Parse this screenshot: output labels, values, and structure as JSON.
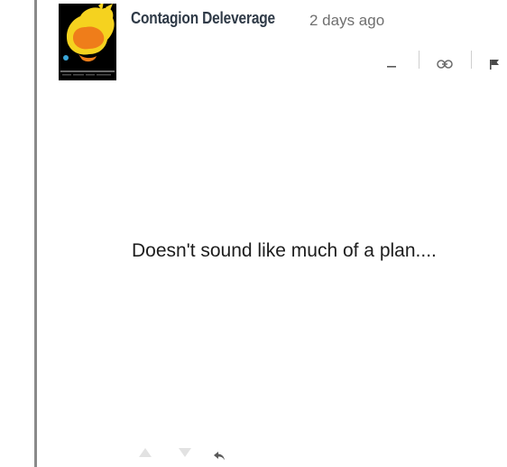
{
  "comment": {
    "author": "Contagion Deleverage",
    "timestamp": "2 days ago",
    "body": "Doesn't sound like much of a plan....",
    "avatar": {
      "icon": "flame-burst-avatar-icon",
      "colors": {
        "background": "#000000",
        "flame_outer": "#f5d21f",
        "flame_inner": "#ef7d1a",
        "accent": "#3aa6d8"
      }
    },
    "actions": {
      "collapse_icon": "minus-icon",
      "permalink_icon": "link-icon",
      "flag_icon": "flag-icon"
    },
    "voting": {
      "upvote_icon": "triangle-up-icon",
      "downvote_icon": "triangle-down-icon",
      "reply_icon": "reply-arrow-icon"
    }
  },
  "colors": {
    "thread_rule": "#8a8a8a",
    "author_text": "#2f3a47",
    "timestamp_text": "#6f6f6f",
    "body_text": "#1d1d1d",
    "icon_muted": "#9e9e9e",
    "icon_vote": "#e2e2e2",
    "icon_reply": "#5a5a5a"
  }
}
